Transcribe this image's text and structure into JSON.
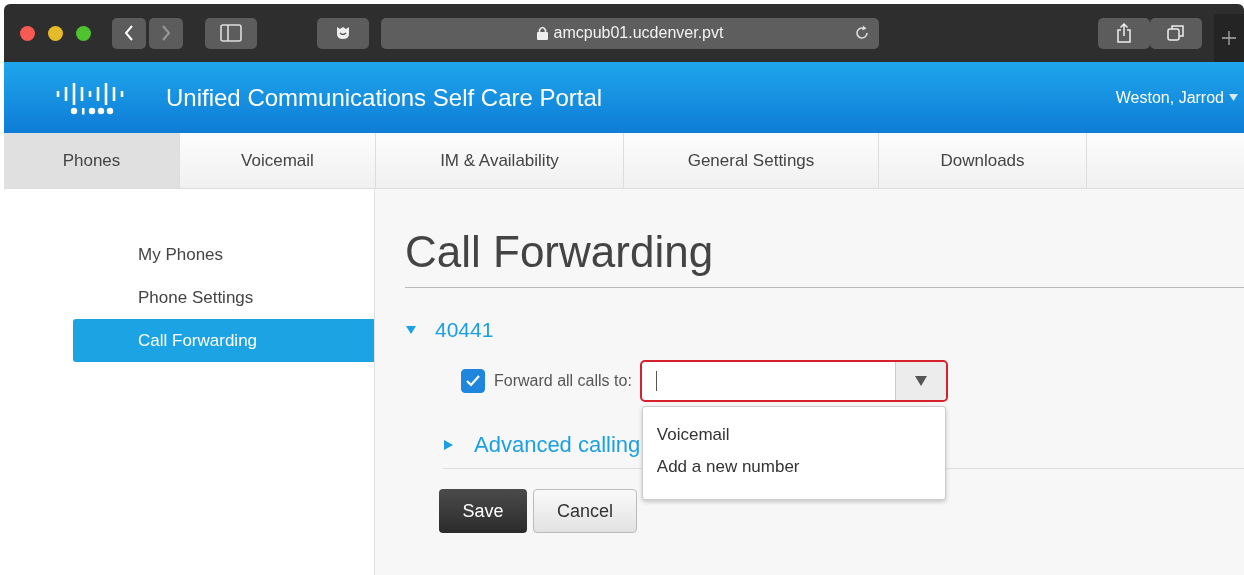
{
  "browser": {
    "url": "amcpub01.ucdenver.pvt"
  },
  "header": {
    "title": "Unified Communications Self Care Portal",
    "user": "Weston, Jarrod"
  },
  "tabs": [
    {
      "label": "Phones",
      "selected": true
    },
    {
      "label": "Voicemail",
      "selected": false
    },
    {
      "label": "IM & Availability",
      "selected": false
    },
    {
      "label": "General Settings",
      "selected": false
    },
    {
      "label": "Downloads",
      "selected": false
    }
  ],
  "sidebar": {
    "items": [
      {
        "label": "My Phones",
        "selected": false
      },
      {
        "label": "Phone Settings",
        "selected": false
      },
      {
        "label": "Call Forwarding",
        "selected": true
      }
    ]
  },
  "page": {
    "title": "Call Forwarding",
    "line": {
      "number": "40441",
      "expanded": true
    },
    "forward_all": {
      "label": "Forward all calls to:",
      "checked": true
    },
    "dropdown": {
      "open": true,
      "options": [
        "Voicemail",
        "Add a new number"
      ]
    },
    "advanced": {
      "label": "Advanced calling",
      "expanded": false
    },
    "buttons": [
      {
        "label": "Save",
        "kind": "primary"
      },
      {
        "label": "Cancel",
        "kind": "secondary"
      }
    ]
  }
}
